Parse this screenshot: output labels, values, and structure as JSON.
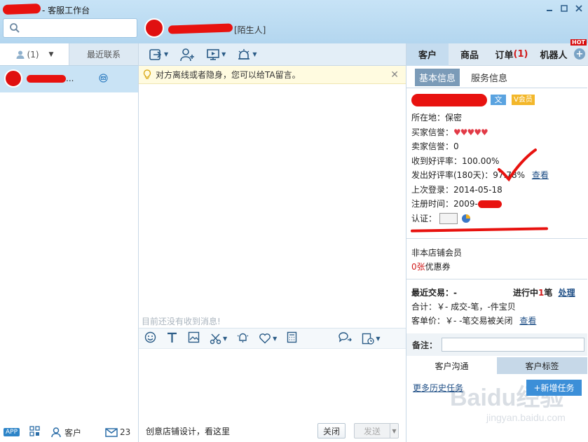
{
  "window": {
    "title": "- 客服工作台"
  },
  "search": {
    "placeholder": ""
  },
  "contact_header": {
    "tag": "[陌生人]"
  },
  "left": {
    "tabs": [
      {
        "label": "(1)"
      },
      {
        "label": "最近联系"
      }
    ],
    "contact": {
      "suffix": "..."
    },
    "footer": {
      "app": "APP",
      "customers": "客户",
      "count": "23"
    }
  },
  "chat": {
    "notice": "对方离线或者隐身，您可以给TA留言。",
    "empty": "目前还没有收到消息!",
    "footer_text": "创意店铺设计，看这里",
    "close_label": "关闭",
    "send_label": "发送"
  },
  "right": {
    "tabs": [
      {
        "label": "客户"
      },
      {
        "label": "商品"
      },
      {
        "label": "订单",
        "count": "(1)"
      },
      {
        "label": "机器人"
      }
    ],
    "hot": "HOT",
    "subtabs": [
      {
        "label": "基本信息"
      },
      {
        "label": "服务信息"
      }
    ],
    "gender": "文",
    "vip": "会员",
    "location": "所在地：保密",
    "buyer_credit_label": "买家信誉：",
    "buyer_credit_icons": "♥♥♥♥♥",
    "seller_credit": "卖家信誉：0",
    "positive_rate": "收到好评率：100.00%",
    "given_rate": "发出好评率(180天)：97.78%",
    "view_label": "查看",
    "last_login": "上次登录：2014-05-18",
    "register": "注册时间：2009-",
    "cert_label": "认证：",
    "member_status": "非本店铺会员",
    "coupon_count": "0张",
    "coupon_label": "优惠券",
    "recent_trade": "最近交易：-",
    "in_progress_prefix": "进行中",
    "in_progress_count": "1",
    "in_progress_suffix": "笔",
    "handle_label": "处理",
    "total": "合计：￥-  成交-笔，-件宝贝",
    "avg_price": "客单价：￥-  -笔交易被关闭",
    "view_label2": "查看",
    "memo_label": "备注：",
    "bottom_tabs": [
      {
        "label": "客户沟通"
      },
      {
        "label": "客户标签"
      }
    ],
    "history_label": "更多历史任务",
    "new_task_label": "+新增任务",
    "watermark": "Baidu经验",
    "watermark_sub": "jingyan.baidu.com"
  }
}
